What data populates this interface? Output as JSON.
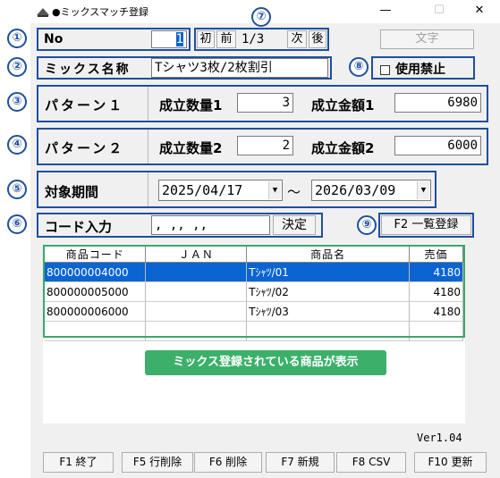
{
  "window": {
    "title": "●ミックスマッチ登録",
    "minimize": "—",
    "maximize": "☐",
    "close": "✕"
  },
  "callouts": [
    "①",
    "②",
    "③",
    "④",
    "⑤",
    "⑥",
    "⑦",
    "⑧",
    "⑨"
  ],
  "record": {
    "no_label": "No",
    "no_value": "1",
    "nav_first": "初",
    "nav_prev": "前",
    "page": "1/3",
    "nav_next": "次",
    "nav_last": "後",
    "moji_button": "文字"
  },
  "mix_name": {
    "label": "ミックス名称",
    "value": "Tシャツ3枚/2枚割引"
  },
  "prohibit": {
    "label": "使用禁止",
    "checked": false
  },
  "pattern1": {
    "label": "パターン１",
    "qty_label": "成立数量1",
    "qty_value": "3",
    "amount_label": "成立金額1",
    "amount_value": "6980"
  },
  "pattern2": {
    "label": "パターン２",
    "qty_label": "成立数量2",
    "qty_value": "2",
    "amount_label": "成立金額2",
    "amount_value": "6000"
  },
  "period": {
    "label": "対象期間",
    "start": "2025/04/17",
    "separator": "～",
    "end": "2026/03/09"
  },
  "code_entry": {
    "label": "コード入力",
    "value": " ,  ,, ,,",
    "confirm_button": "決定"
  },
  "list_register_button": "F2 一覧登録",
  "table": {
    "headers": [
      "商品コード",
      "ＪＡＮ",
      "商品名",
      "売価"
    ],
    "rows": [
      {
        "code": "800000004000",
        "jan": "",
        "name": "Tｼｬﾂ/01",
        "price": "4180"
      },
      {
        "code": "800000005000",
        "jan": "",
        "name": "Tｼｬﾂ/02",
        "price": "4180"
      },
      {
        "code": "800000006000",
        "jan": "",
        "name": "Tｼｬﾂ/03",
        "price": "4180"
      }
    ]
  },
  "note": "ミックス登録されている商品が表示",
  "version": "Ver1.04",
  "fkeys": {
    "f1": "F1 終了",
    "f5": "F5 行削除",
    "f6": "F6 削除",
    "f7": "F7 新規",
    "f8": "F8 CSV",
    "f10": "F10 更新"
  }
}
